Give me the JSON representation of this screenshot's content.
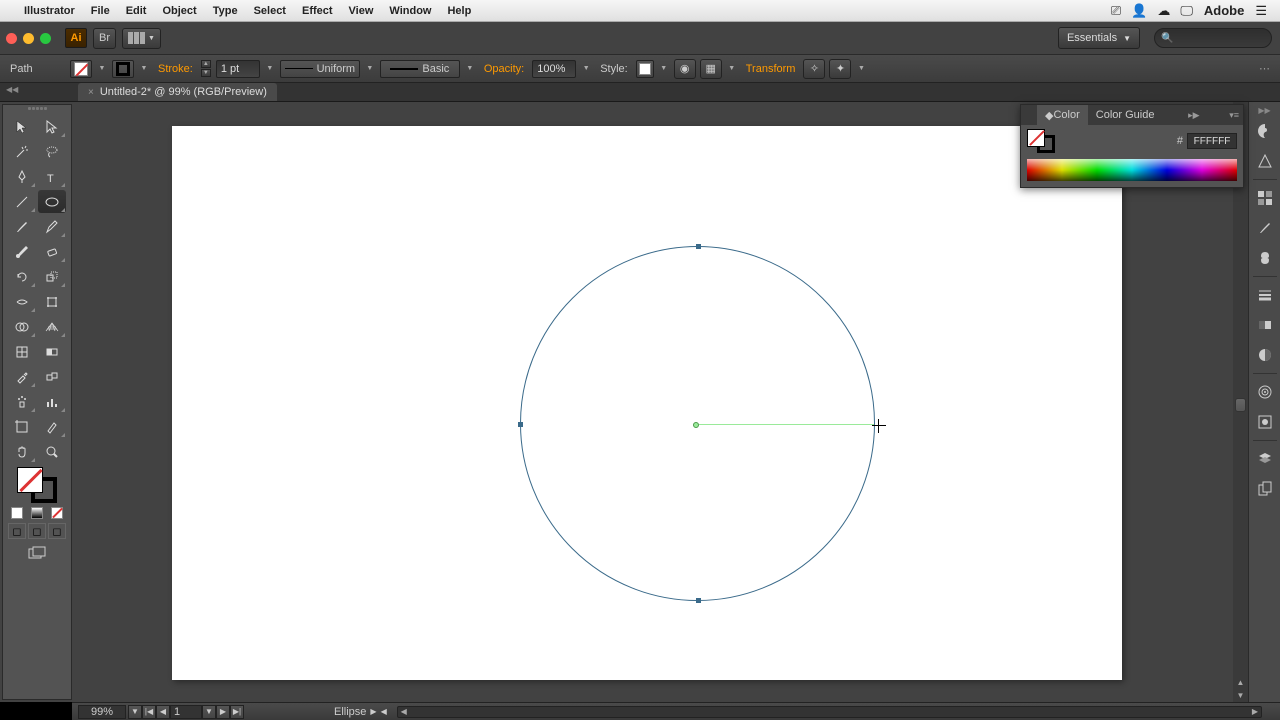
{
  "mac_menu": {
    "app": "Illustrator",
    "items": [
      "File",
      "Edit",
      "Object",
      "Type",
      "Select",
      "Effect",
      "View",
      "Window",
      "Help"
    ],
    "brand": "Adobe"
  },
  "app_bar": {
    "ai": "Ai",
    "br": "Br",
    "workspace": "Essentials"
  },
  "control": {
    "selection": "Path",
    "stroke_label": "Stroke:",
    "stroke_weight": "1 pt",
    "profile": "Uniform",
    "brush": "Basic",
    "opacity_label": "Opacity:",
    "opacity": "100%",
    "style_label": "Style:",
    "transform": "Transform"
  },
  "doc_tab": {
    "name": "Untitled-2* @ 99% (RGB/Preview)"
  },
  "color_panel": {
    "tab1": "Color",
    "tab2": "Color Guide",
    "hash": "#",
    "hex": "FFFFFF"
  },
  "status": {
    "zoom": "99%",
    "artboard": "1",
    "tool": "Ellipse"
  }
}
